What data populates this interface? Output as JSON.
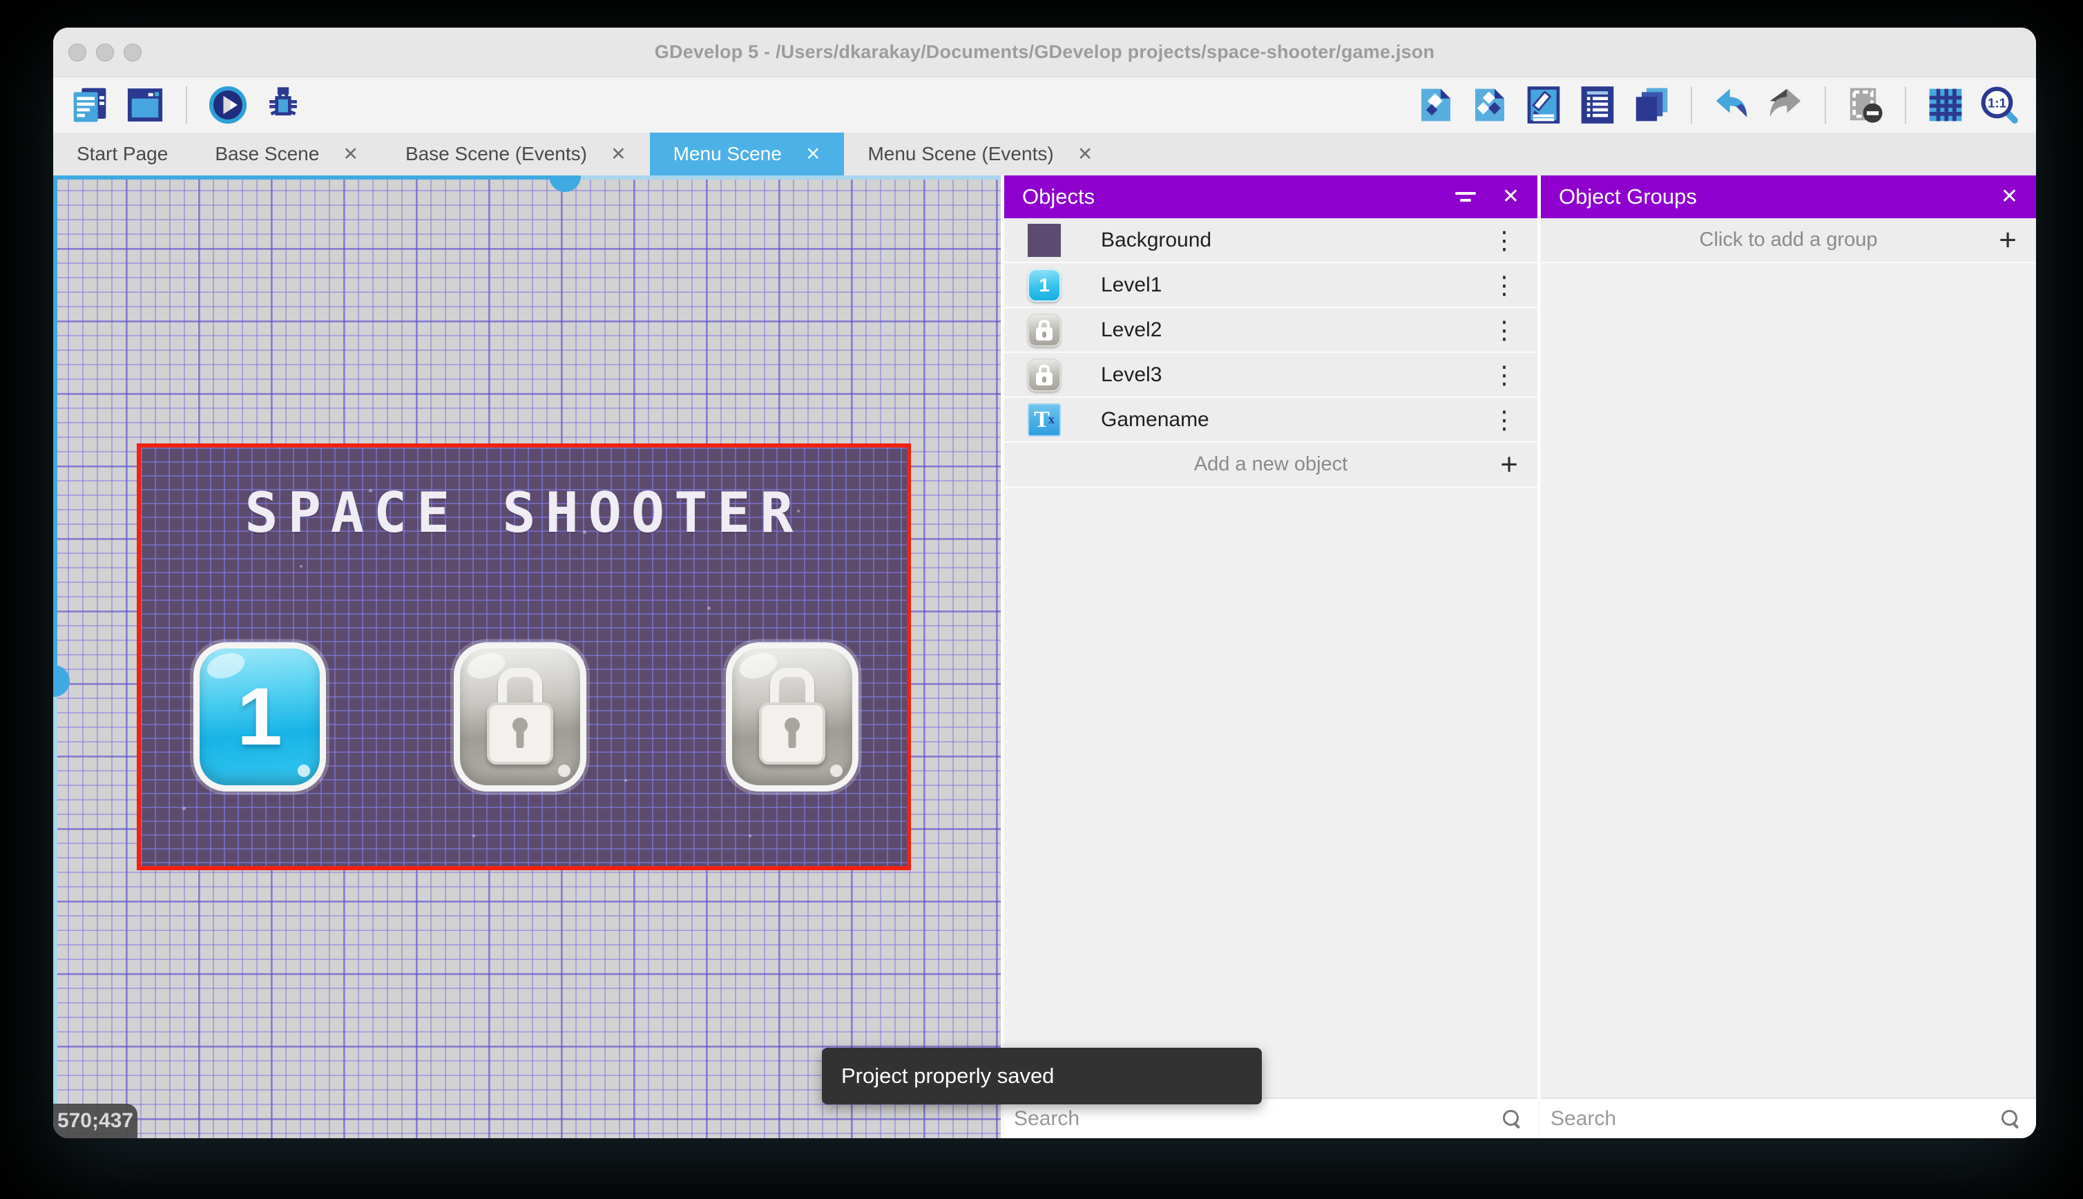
{
  "window": {
    "title": "GDevelop 5 - /Users/dkarakay/Documents/GDevelop projects/space-shooter/game.json",
    "traffic_lights": [
      "close",
      "minimize",
      "zoom"
    ]
  },
  "colors": {
    "panel_header_purple": "#8f00ce",
    "active_tab_blue": "#4cb1e6",
    "selection_red": "#f1220f",
    "scene_background": "#5d4b6e",
    "toolbar_icon_blue": "#45a5dc",
    "toolbar_icon_navy": "#2b3990",
    "canvas_grid_line": "#7d73da",
    "toast_background": "#323232"
  },
  "icons": {
    "close": "✕",
    "plus": "+",
    "kebab": "⋮",
    "left_toolbar": [
      "project-manager-icon",
      "preview-window-icon",
      "play-preview-icon",
      "debug-icon"
    ],
    "right_toolbar": [
      "objects-editor-icon",
      "object-groups-editor-icon",
      "properties-icon",
      "instances-list-icon",
      "layers-icon",
      "undo-icon",
      "redo-icon",
      "toggle-mask-icon",
      "toggle-grid-icon",
      "zoom-icon"
    ]
  },
  "toolbar": {
    "zoom_label": "1:1"
  },
  "tabs": [
    {
      "label": "Start Page",
      "closable": false,
      "active": false
    },
    {
      "label": "Base Scene",
      "closable": true,
      "active": false
    },
    {
      "label": "Base Scene (Events)",
      "closable": true,
      "active": false
    },
    {
      "label": "Menu Scene",
      "closable": true,
      "active": true
    },
    {
      "label": "Menu Scene (Events)",
      "closable": true,
      "active": false
    }
  ],
  "canvas": {
    "coordinates": "570;437",
    "scene_title": "SPACE SHOOTER",
    "buttons": [
      {
        "label": "1",
        "state": "unlocked"
      },
      {
        "label": "",
        "state": "locked"
      },
      {
        "label": "",
        "state": "locked"
      }
    ]
  },
  "objects_panel": {
    "title": "Objects",
    "items": [
      {
        "label": "Background",
        "thumb": "background-swatch"
      },
      {
        "label": "Level1",
        "thumb": "level-button-1",
        "thumb_text": "1"
      },
      {
        "label": "Level2",
        "thumb": "locked-button"
      },
      {
        "label": "Level3",
        "thumb": "locked-button"
      },
      {
        "label": "Gamename",
        "thumb": "text-object",
        "thumb_main": "T",
        "thumb_sub": "x"
      }
    ],
    "add_label": "Add a new object",
    "search_placeholder": "Search"
  },
  "groups_panel": {
    "title": "Object Groups",
    "add_label": "Click to add a group",
    "search_placeholder": "Search"
  },
  "toast": {
    "message": "Project properly saved"
  }
}
